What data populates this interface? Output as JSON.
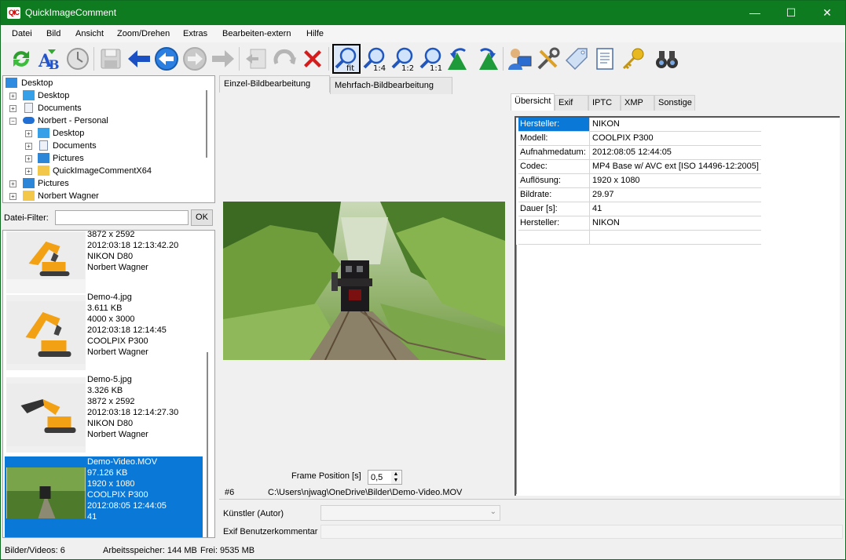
{
  "window": {
    "title": "QuickImageComment",
    "logo_text": "QIC",
    "accent": "#0f7b21",
    "controls": {
      "minimize": "—",
      "maximize": "☐",
      "close": "✕"
    }
  },
  "menu": [
    "Datei",
    "Bild",
    "Ansicht",
    "Zoom/Drehen",
    "Extras",
    "Bearbeiten-extern",
    "Hilfe"
  ],
  "toolbar": {
    "zoom_labels": [
      "fit",
      "1:4",
      "1:2",
      "1:1"
    ],
    "icons": [
      "refresh-icon",
      "rename-icon",
      "clock-icon",
      "save-icon",
      "previous-icon",
      "previous-circle-icon",
      "next-circle-icon",
      "next-icon",
      "import-icon",
      "rotate-icon",
      "delete-icon",
      "zoom-fit-icon",
      "zoom-1-4-icon",
      "zoom-1-2-icon",
      "zoom-1-1-icon",
      "rotate-left-icon",
      "rotate-right-icon",
      "user-config-icon",
      "settings-icon",
      "tag-icon",
      "document-icon",
      "key-icon",
      "binoculars-icon"
    ]
  },
  "tree": {
    "items": [
      {
        "label": "Desktop",
        "level": 0,
        "icon": "desktop-icon",
        "expander": ""
      },
      {
        "label": "Desktop",
        "level": 1,
        "icon": "desktop-icon",
        "expander": "+"
      },
      {
        "label": "Documents",
        "level": 1,
        "icon": "document-icon",
        "expander": "+"
      },
      {
        "label": "Norbert - Personal",
        "level": 1,
        "icon": "cloud-icon",
        "expander": "−"
      },
      {
        "label": "Desktop",
        "level": 2,
        "icon": "desktop-icon",
        "expander": "+"
      },
      {
        "label": "Documents",
        "level": 2,
        "icon": "document-icon",
        "expander": "+"
      },
      {
        "label": "Pictures",
        "level": 2,
        "icon": "pictures-icon",
        "expander": "+"
      },
      {
        "label": "QuickImageCommentX64",
        "level": 2,
        "icon": "folder-icon",
        "expander": "+"
      },
      {
        "label": "Pictures",
        "level": 1,
        "icon": "pictures-icon",
        "expander": "+"
      },
      {
        "label": "Norbert Wagner",
        "level": 1,
        "icon": "folder-icon",
        "expander": "+"
      }
    ]
  },
  "filter": {
    "label": "Datei-Filter:",
    "value": "",
    "ok": "OK"
  },
  "thumbnails": [
    {
      "text": "3872 x 2592\n2012:03:18 12:13:42.20\nNIKON D80\nNorbert Wagner",
      "selected": false
    },
    {
      "text": "Demo-4.jpg\n3.611 KB\n4000 x 3000\n2012:03:18 12:14:45\nCOOLPIX P300\nNorbert Wagner",
      "selected": false
    },
    {
      "text": "Demo-5.jpg\n3.326 KB\n3872 x 2592\n2012:03:18 12:14:27.30\nNIKON D80\nNorbert Wagner",
      "selected": false
    },
    {
      "text": "Demo-Video.MOV\n97.126 KB\n1920 x 1080\nCOOLPIX P300\n2012:08:05 12:44:05\n41",
      "selected": true
    }
  ],
  "main_tabs": [
    "Einzel-Bildbearbeitung",
    "Mehrfach-Bildbearbeitung"
  ],
  "frame": {
    "label": "Frame Position [s]",
    "value": "0,5"
  },
  "file": {
    "index": "#6",
    "path": "C:\\Users\\njwag\\OneDrive\\Bilder\\Demo-Video.MOV"
  },
  "fields": {
    "artist_label": "Künstler (Autor)",
    "artist_value": "",
    "comment_label": "Exif Benutzerkommentar",
    "comment_value": ""
  },
  "prop_tabs": [
    "Übersicht",
    "Exif",
    "IPTC",
    "XMP",
    "Sonstige"
  ],
  "properties": [
    {
      "key": "Hersteller:",
      "value": "NIKON"
    },
    {
      "key": "Modell:",
      "value": "COOLPIX P300"
    },
    {
      "key": "Aufnahmedatum:",
      "value": "2012:08:05 12:44:05"
    },
    {
      "key": "Codec:",
      "value": "MP4 Base w/ AVC ext [ISO 14496-12:2005]"
    },
    {
      "key": "Auflösung:",
      "value": "1920 x 1080"
    },
    {
      "key": "Bildrate:",
      "value": "29.97"
    },
    {
      "key": "Dauer [s]:",
      "value": "41"
    },
    {
      "key": "Hersteller:",
      "value": "NIKON"
    },
    {
      "key": "",
      "value": ""
    }
  ],
  "status": {
    "count": "Bilder/Videos: 6",
    "memory": "Arbeitsspeicher: 144 MB",
    "free": "Frei: 9535 MB"
  }
}
